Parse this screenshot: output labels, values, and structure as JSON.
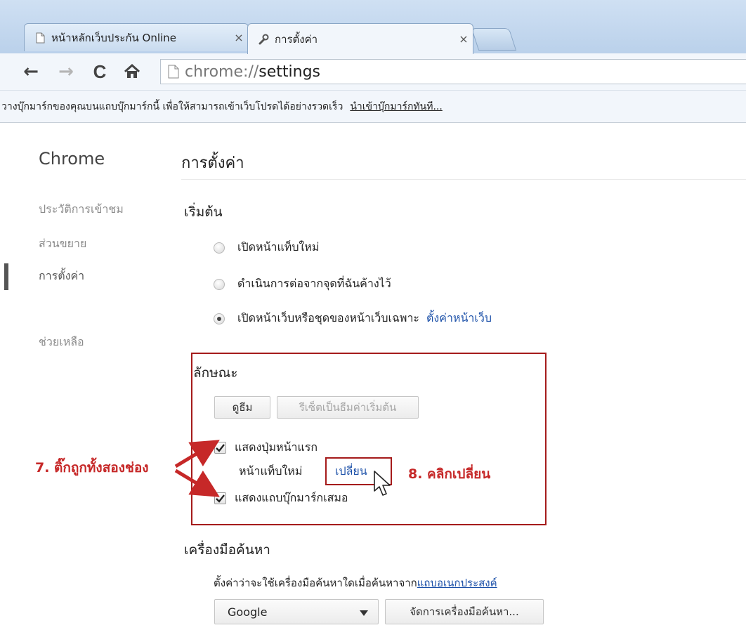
{
  "tabs": [
    {
      "label": "หน้าหลักเว็บประกัน Online",
      "close": "×",
      "icon": "page-icon"
    },
    {
      "label": "การตั้งค่า",
      "close": "×",
      "icon": "wrench-icon"
    }
  ],
  "toolbar": {
    "back": "←",
    "forward": "→",
    "reload": "C",
    "home": "home-icon",
    "url_scheme": "chrome://",
    "url_path": "settings"
  },
  "bookmark_bar": {
    "message": "วางบุ๊กมาร์กของคุณบนแถบบุ๊กมาร์กนี้ เพื่อให้สามารถเข้าเว็บโปรดได้อย่างรวดเร็ว",
    "import_link": "นำเข้าบุ๊กมาร์กทันที..."
  },
  "sidebar": {
    "brand": "Chrome",
    "items": [
      {
        "label": "ประวัติการเข้าชม"
      },
      {
        "label": "ส่วนขยาย"
      },
      {
        "label": "การตั้งค่า"
      },
      {
        "label": "ช่วยเหลือ"
      }
    ]
  },
  "page": {
    "title": "การตั้งค่า"
  },
  "startup": {
    "heading": "เริ่มต้น",
    "options": [
      {
        "label": "เปิดหน้าแท็บใหม่",
        "checked": false
      },
      {
        "label": "ดำเนินการต่อจากจุดที่ฉันค้างไว้",
        "checked": false
      },
      {
        "label": "เปิดหน้าเว็บหรือชุดของหน้าเว็บเฉพาะ",
        "checked": true
      }
    ],
    "set_pages_link": "ตั้งค่าหน้าเว็บ"
  },
  "appearance": {
    "heading": "ลักษณะ",
    "get_themes": "ดูธีม",
    "reset_theme": "รีเซ็ตเป็นธีมค่าเริ่มต้น",
    "show_home_button": "แสดงปุ่มหน้าแรก",
    "home_page_label": "หน้าแท็บใหม่",
    "change_link": "เปลี่ยน",
    "show_bookmarks_bar": "แสดงแถบบุ๊กมาร์กเสมอ"
  },
  "annotations": {
    "step7": "7. ติ๊กถูกทั้งสองช่อง",
    "step8": "8. คลิกเปลี่ยน",
    "color": "#c62828"
  },
  "search": {
    "heading": "เครื่องมือค้นหา",
    "description": "ตั้งค่าว่าจะใช้เครื่องมือค้นหาใดเมื่อค้นหาจาก",
    "omnibox_link": "แถบอเนกประสงค์",
    "engine": "Google",
    "manage_button": "จัดการเครื่องมือค้นหา..."
  }
}
